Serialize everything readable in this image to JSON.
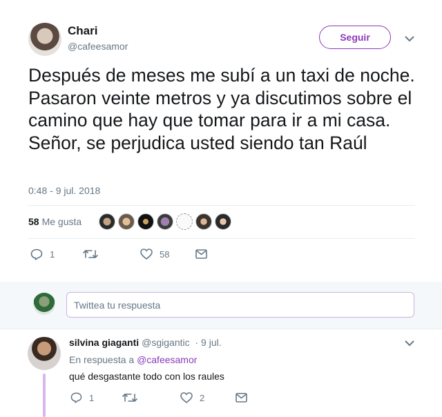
{
  "tweet": {
    "author_name": "Chari",
    "author_handle": "@cafeesamor",
    "follow_label": "Seguir",
    "text": "Después de meses me subí a un taxi de noche. Pasaron veinte metros y ya discutimos sobre el camino que hay que tomar para ir a mi casa. Señor, se perjudica usted siendo tan Raúl",
    "timestamp": "0:48 - 9 jul. 2018",
    "likes_count": "58",
    "likes_label": "Me gusta",
    "actions": {
      "reply_count": "1",
      "retweet_count": "",
      "like_count": "58"
    }
  },
  "reply_box": {
    "placeholder": "Twittea tu respuesta"
  },
  "reply": {
    "author_name": "silvina giaganti",
    "author_handle": "@sgigantic",
    "date": "· 9 jul.",
    "in_reply_prefix": "En respuesta a",
    "in_reply_handle": "@cafeesamor",
    "text": "qué desgastante todo con los raules",
    "actions": {
      "reply_count": "1",
      "retweet_count": "",
      "like_count": "2"
    }
  },
  "icons": {
    "reply": "reply-icon",
    "retweet": "retweet-icon",
    "like": "heart-icon",
    "message": "envelope-icon",
    "more": "chevron-down-icon"
  },
  "colors": {
    "accent": "#8a3ab9",
    "muted": "#657786",
    "text": "#14171a",
    "divider": "#e6ecf0"
  }
}
